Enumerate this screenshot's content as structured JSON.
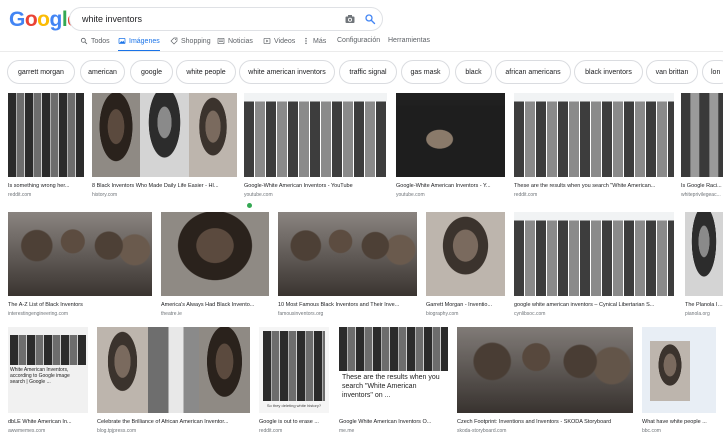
{
  "logo": {
    "letters": [
      "G",
      "o",
      "o",
      "g",
      "l",
      "e"
    ],
    "colors": [
      "#4285f4",
      "#ea4335",
      "#fbbc05",
      "#4285f4",
      "#34a853",
      "#ea4335"
    ]
  },
  "search": {
    "query": "white inventors",
    "camera_icon": "camera-icon",
    "search_icon": "search-icon"
  },
  "tabs": [
    {
      "label": "Todos",
      "icon": "search-icon"
    },
    {
      "label": "Imágenes",
      "icon": "image-icon",
      "active": true
    },
    {
      "label": "Shopping",
      "icon": "tag-icon"
    },
    {
      "label": "Noticias",
      "icon": "news-icon"
    },
    {
      "label": "Videos",
      "icon": "play-icon"
    },
    {
      "label": "Más",
      "icon": "more-icon"
    },
    {
      "label": "Configuración"
    },
    {
      "label": "Herramientas"
    }
  ],
  "chips": [
    "garrett morgan",
    "american",
    "google",
    "white people",
    "white american inventors",
    "traffic signal",
    "gas mask",
    "black",
    "african americans",
    "black inventors",
    "van brittan",
    "lon"
  ],
  "results": [
    {
      "caption": "Is something wrong her...",
      "source": "reddit.com"
    },
    {
      "caption": "8 Black Inventors Who Made Daily Life Easier - HI...",
      "source": "history.com"
    },
    {
      "caption": "Google-White American Inventors - YouTube",
      "source": "youtube.com"
    },
    {
      "caption": "Google-White American Inventors - Y...",
      "source": "youtube.com"
    },
    {
      "caption": "These are the results when you search \"White American...",
      "source": "reddit.com"
    },
    {
      "caption": "Is Google Raci...",
      "source": "whiteprivilegeac..."
    },
    {
      "caption": "The A-Z List of Black Inventors",
      "source": "interestingengineering.com"
    },
    {
      "caption": "America's Always Had Black Invento...",
      "source": "theatre.ie"
    },
    {
      "caption": "10 Most Famous Black Inventors and Their Inve...",
      "source": "famousinventors.org"
    },
    {
      "caption": "Garrett Morgan - Inventio...",
      "source": "biography.com"
    },
    {
      "caption": "google white american inventors – Cynical Libertarian S...",
      "source": "cynlibsoc.com"
    },
    {
      "caption": "The Planola In...",
      "source": "pianola.org"
    },
    {
      "caption": "dbLE White American In...",
      "source": "awwmemes.com"
    },
    {
      "caption": "Celebrate the Brilliance of African American Inventor...",
      "source": "blog.tpjpress.com"
    },
    {
      "caption": "Google is out to erase ...",
      "source": "reddit.com"
    },
    {
      "caption": "Google White American Inventors O...",
      "source": "me.me"
    },
    {
      "caption": "Czech Footprint: Inventions and Inventors - ŠKODA Storyboard",
      "source": "skoda-storyboard.com"
    },
    {
      "caption": "What have white people ...",
      "source": "bbc.com"
    }
  ],
  "overlay_texts": {
    "meme_left": "White American Inventors, according to Google image search | Google ...",
    "meme_mid": "These are the results when you search \"White American inventors\" on ...",
    "meme_small": "So they deleting white history?"
  }
}
